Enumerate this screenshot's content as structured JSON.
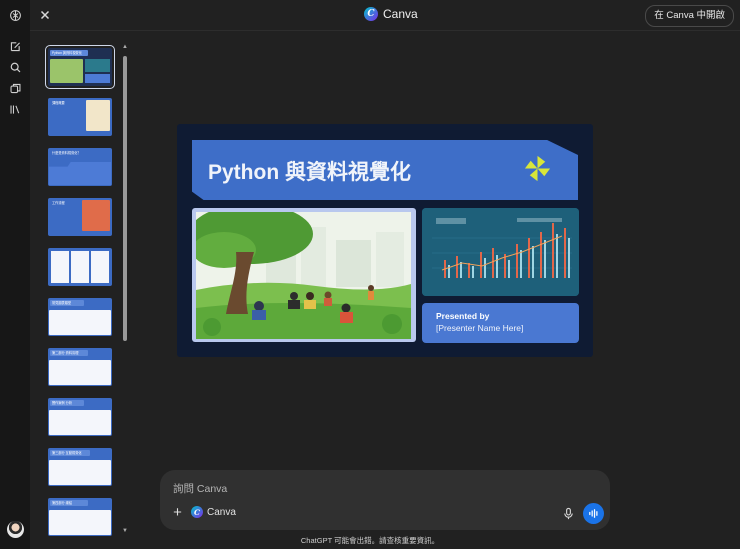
{
  "app": {
    "title": "Canva",
    "open_button": "在 Canva 中開啟"
  },
  "sidebar": {
    "icons": [
      "openai-logo-icon",
      "new-chat-icon",
      "search-icon",
      "images-icon",
      "library-icon"
    ]
  },
  "slide_thumbnails": [
    {
      "title": "Python 與資料視覺化",
      "selected": true
    },
    {
      "title": "課程概要",
      "selected": false
    },
    {
      "title": "什麼是資料視覺化？",
      "selected": false
    },
    {
      "title": "工作流程",
      "selected": false
    },
    {
      "title": "",
      "selected": false
    },
    {
      "title": "常見圖表類型",
      "selected": false
    },
    {
      "title": "第二部分 資料清理",
      "selected": false
    },
    {
      "title": "實作案例 分析",
      "selected": false
    },
    {
      "title": "第三部分 互動視覺化",
      "selected": false
    },
    {
      "title": "第四部分 總結",
      "selected": false
    }
  ],
  "slide": {
    "title": "Python 與資料視覺化",
    "presenter_label": "Presented by",
    "presenter_name": "[Presenter Name Here]"
  },
  "composer": {
    "placeholder": "詢問 Canva",
    "tool_label": "Canva"
  },
  "footer": {
    "disclaimer": "ChatGPT 可能會出錯。請查核重要資訊。"
  },
  "colors": {
    "background": "#212121",
    "rail": "#171717",
    "slide_bg": "#0f1b33",
    "slide_blue": "#3e6ec8",
    "send_button": "#1a73e8",
    "accent_yellow": "#d8e63a"
  }
}
